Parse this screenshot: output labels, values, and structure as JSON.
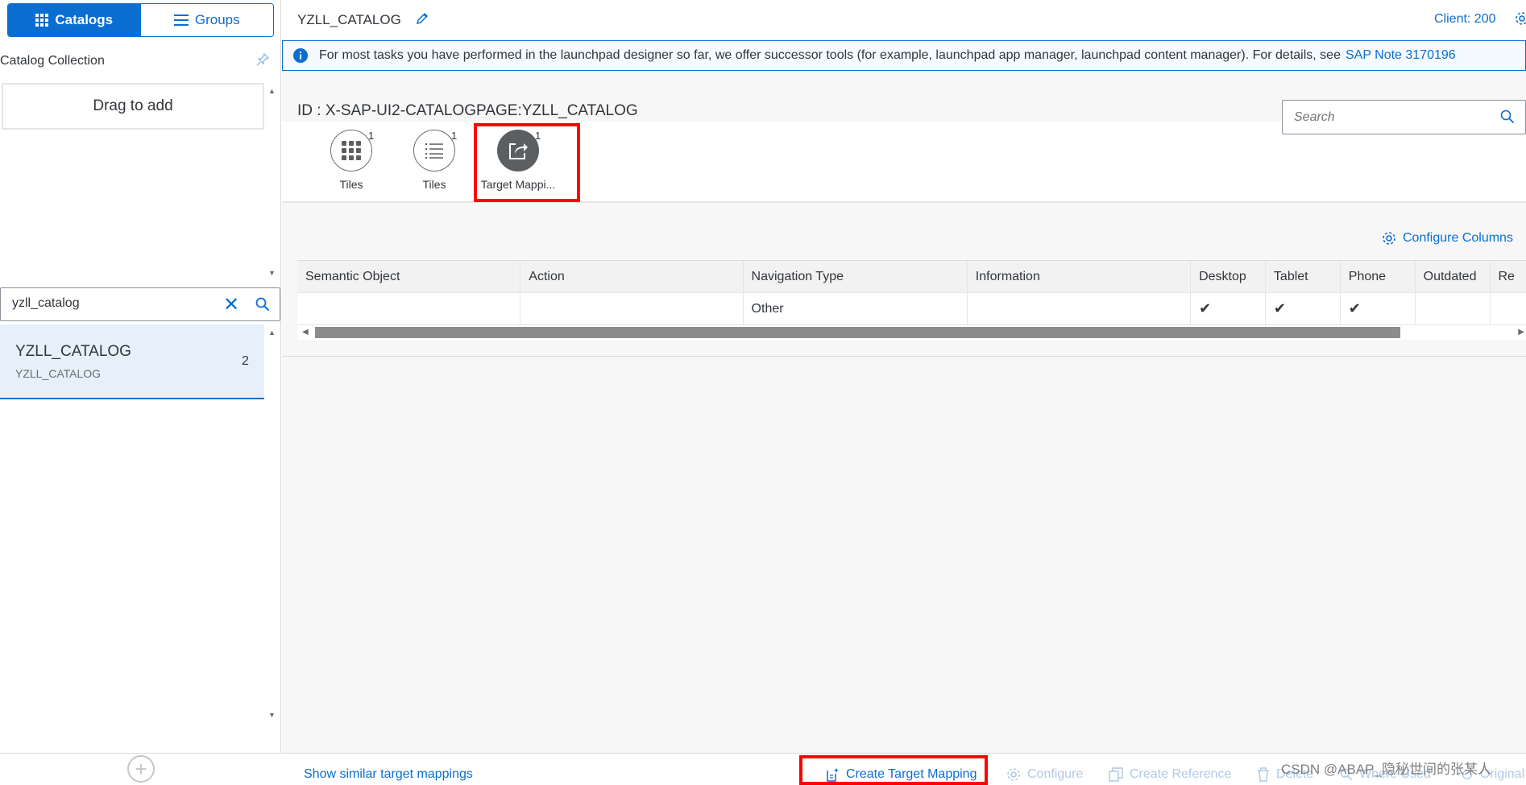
{
  "left_panel": {
    "catalogs_label": "Catalogs",
    "groups_label": "Groups",
    "collection_title": "Catalog Collection",
    "drag_to_add": "Drag to add",
    "search_value": "yzll_catalog",
    "catalog_item": {
      "title": "YZLL_CATALOG",
      "subtitle": "YZLL_CATALOG",
      "count": "2"
    }
  },
  "header": {
    "catalog_name": "YZLL_CATALOG",
    "client": "Client: 200"
  },
  "info": {
    "text": "For most tasks you have performed in the launchpad designer so far, we offer successor tools (for example, launchpad app manager, launchpad content manager). For details, see",
    "link": "SAP Note 3170196"
  },
  "catalog_id": "ID : X-SAP-UI2-CATALOGPAGE:YZLL_CATALOG",
  "search_placeholder": "Search",
  "tabs": [
    {
      "label": "Tiles",
      "count": "1",
      "icon": "grid-icon"
    },
    {
      "label": "Tiles",
      "count": "1",
      "icon": "list-icon"
    },
    {
      "label": "Target Mappi...",
      "count": "1",
      "icon": "share-icon",
      "selected": true
    }
  ],
  "configure_columns": "Configure Columns",
  "table": {
    "columns": [
      "Semantic Object",
      "Action",
      "Navigation Type",
      "Information",
      "Desktop",
      "Tablet",
      "Phone",
      "Outdated",
      "Re"
    ],
    "rows": [
      [
        "",
        "",
        "Other",
        "",
        "✔",
        "✔",
        "✔",
        "",
        ""
      ]
    ]
  },
  "footer": {
    "show_similar": "Show similar target mappings",
    "create_target_mapping": "Create Target Mapping",
    "configure": "Configure",
    "create_reference": "Create Reference",
    "delete": "Delete",
    "where_used": "Where Used",
    "original": "Original"
  },
  "watermark": "CSDN @ABAP_隐秘世间的张某人",
  "colors": {
    "accent": "#0a6ed1",
    "highlight": "#ff0000",
    "selected_bg": "#e5f0fa"
  }
}
